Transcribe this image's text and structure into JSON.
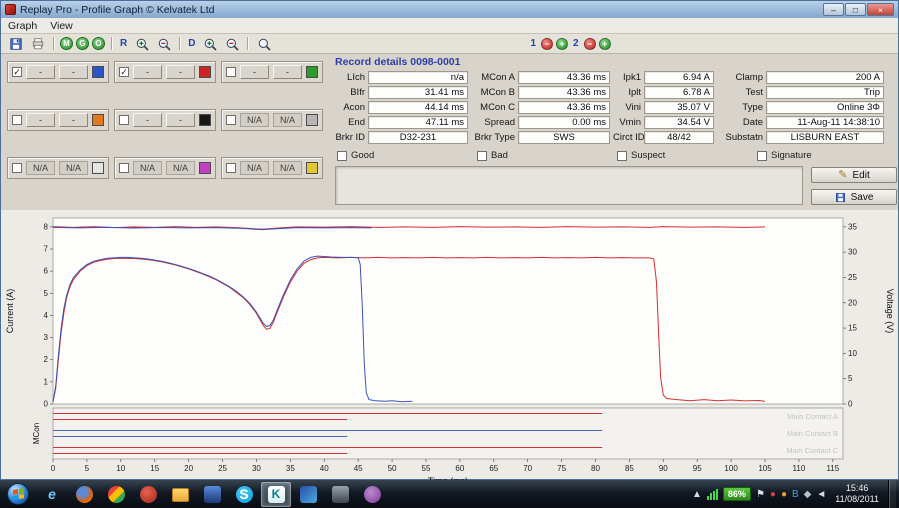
{
  "window": {
    "title": "Replay Pro - Profile Graph © Kelvatek Ltd",
    "menu": [
      "Graph",
      "View"
    ],
    "controls": {
      "minimize": "–",
      "maximize": "□",
      "close": "×"
    },
    "toolbar": {
      "green_letters": [
        "M",
        "G",
        "O"
      ],
      "r_label": "R",
      "d_label": "D",
      "cursor1_label": "1",
      "cursor2_label": "2",
      "minus_glyph": "−",
      "plus_glyph": "+"
    }
  },
  "channels": [
    {
      "checked": true,
      "btn1": "-",
      "btn2": "-",
      "color": "#2d55c8"
    },
    {
      "checked": true,
      "btn1": "-",
      "btn2": "-",
      "color": "#cc2424"
    },
    {
      "checked": false,
      "btn1": "-",
      "btn2": "-",
      "color": "#2d9a2d"
    },
    {
      "checked": false,
      "btn1": "-",
      "btn2": "-",
      "color": "#e07a20"
    },
    {
      "checked": false,
      "btn1": "-",
      "btn2": "-",
      "color": "#161616"
    },
    {
      "checked": false,
      "btn1": "N/A",
      "btn2": "N/A",
      "color": "#b5b5b5"
    },
    {
      "checked": false,
      "btn1": "N/A",
      "btn2": "N/A",
      "color": "#e4e4e4"
    },
    {
      "checked": false,
      "btn1": "N/A",
      "btn2": "N/A",
      "color": "#c43fc4"
    },
    {
      "checked": false,
      "btn1": "N/A",
      "btn2": "N/A",
      "color": "#e3c832"
    }
  ],
  "record": {
    "header": "Record details 0098-0001",
    "rows": [
      [
        {
          "label": "LIch",
          "value": "n/a"
        },
        {
          "label": "MCon A",
          "value": "43.36 ms"
        },
        {
          "label": "Ipk1",
          "value": "6.94 A"
        },
        {
          "label": "Clamp",
          "value": "200 A"
        }
      ],
      [
        {
          "label": "BIfr",
          "value": "31.41 ms"
        },
        {
          "label": "MCon B",
          "value": "43.36 ms"
        },
        {
          "label": "Iplt",
          "value": "6.78 A"
        },
        {
          "label": "Test",
          "value": "Trip"
        }
      ],
      [
        {
          "label": "Acon",
          "value": "44.14 ms"
        },
        {
          "label": "MCon C",
          "value": "43.36 ms"
        },
        {
          "label": "Vini",
          "value": "35.07 V"
        },
        {
          "label": "Type",
          "value": "Online 3Φ"
        }
      ],
      [
        {
          "label": "End",
          "value": "47.11 ms"
        },
        {
          "label": "Spread",
          "value": "0.00 ms"
        },
        {
          "label": "Vmin",
          "value": "34.54 V"
        },
        {
          "label": "Date",
          "value": "11-Aug-11 14:38:10"
        }
      ],
      [
        {
          "label": "Brkr ID",
          "value": "D32-231"
        },
        {
          "label": "Brkr Type",
          "value": "SWS"
        },
        {
          "label": "Circt ID",
          "value": "48/42"
        },
        {
          "label": "Substatn",
          "value": "LISBURN EAST"
        }
      ]
    ],
    "flags": [
      "Good",
      "Bad",
      "Suspect",
      "Signature"
    ],
    "buttons": {
      "edit": "Edit",
      "save": "Save"
    }
  },
  "chart_data": {
    "type": "line",
    "xlabel": "Time (ms)",
    "ylabel_left": "Current (A)",
    "ylabel_right": "Voltage (V)",
    "contacts_label": "MCon",
    "x_ticks": [
      0,
      5,
      10,
      15,
      20,
      25,
      30,
      35,
      40,
      45,
      50,
      55,
      60,
      65,
      70,
      75,
      80,
      85,
      90,
      95,
      100,
      105,
      110,
      115
    ],
    "current_ticks": [
      0,
      1,
      2,
      3,
      4,
      5,
      6,
      7,
      8
    ],
    "voltage_ticks": [
      0,
      5,
      10,
      15,
      20,
      25,
      30,
      35
    ],
    "xlim": [
      0,
      115
    ],
    "current_lim": [
      0,
      8
    ],
    "voltage_lim": [
      0,
      35
    ],
    "series": [
      {
        "name": "voltage-red",
        "axis": "voltage",
        "color": "#d42f2f",
        "points": [
          [
            0,
            35.05
          ],
          [
            3,
            34.9
          ],
          [
            6,
            35.05
          ],
          [
            9,
            34.85
          ],
          [
            12,
            35.0
          ],
          [
            15,
            34.9
          ],
          [
            18,
            35.05
          ],
          [
            21,
            34.9
          ],
          [
            24,
            35.0
          ],
          [
            27,
            34.85
          ],
          [
            30,
            34.6
          ],
          [
            31,
            34.55
          ],
          [
            32,
            34.65
          ],
          [
            34,
            34.85
          ],
          [
            36,
            35.0
          ],
          [
            40,
            34.95
          ],
          [
            44,
            35.05
          ],
          [
            48,
            34.9
          ],
          [
            52,
            35.0
          ],
          [
            56,
            34.9
          ],
          [
            60,
            35.05
          ],
          [
            64,
            34.95
          ],
          [
            68,
            35.0
          ],
          [
            72,
            34.9
          ],
          [
            76,
            35.05
          ],
          [
            80,
            34.95
          ],
          [
            84,
            35.0
          ],
          [
            88,
            34.9
          ],
          [
            90,
            35.05
          ],
          [
            94,
            34.95
          ],
          [
            98,
            35.0
          ],
          [
            102,
            34.9
          ],
          [
            105,
            35.0
          ]
        ]
      },
      {
        "name": "voltage-blue",
        "axis": "voltage",
        "color": "#3a53b4",
        "points": [
          [
            0,
            34.9
          ],
          [
            4,
            34.8
          ],
          [
            8,
            34.9
          ],
          [
            12,
            34.78
          ],
          [
            16,
            34.88
          ],
          [
            20,
            34.8
          ],
          [
            24,
            34.85
          ],
          [
            28,
            34.7
          ],
          [
            30,
            34.5
          ],
          [
            31,
            34.45
          ],
          [
            32,
            34.55
          ],
          [
            34,
            34.7
          ],
          [
            36,
            34.85
          ],
          [
            40,
            34.8
          ],
          [
            44,
            34.85
          ],
          [
            47,
            34.8
          ]
        ]
      },
      {
        "name": "current-red",
        "axis": "current",
        "color": "#d42f2f",
        "points": [
          [
            0,
            0.1
          ],
          [
            0.4,
            0.7
          ],
          [
            0.8,
            2.0
          ],
          [
            1.2,
            3.2
          ],
          [
            1.6,
            4.1
          ],
          [
            2,
            4.8
          ],
          [
            2.5,
            5.3
          ],
          [
            3,
            5.6
          ],
          [
            4,
            6.0
          ],
          [
            5,
            6.25
          ],
          [
            6,
            6.4
          ],
          [
            7,
            6.48
          ],
          [
            8,
            6.54
          ],
          [
            9,
            6.57
          ],
          [
            10,
            6.58
          ],
          [
            12,
            6.57
          ],
          [
            14,
            6.52
          ],
          [
            16,
            6.42
          ],
          [
            18,
            6.28
          ],
          [
            20,
            6.1
          ],
          [
            22,
            5.88
          ],
          [
            24,
            5.62
          ],
          [
            26,
            5.28
          ],
          [
            28,
            4.82
          ],
          [
            29,
            4.5
          ],
          [
            30,
            4.1
          ],
          [
            30.5,
            3.82
          ],
          [
            31,
            3.55
          ],
          [
            31.5,
            3.38
          ],
          [
            32,
            3.42
          ],
          [
            32.5,
            3.7
          ],
          [
            33,
            4.1
          ],
          [
            34,
            4.85
          ],
          [
            35,
            5.5
          ],
          [
            36,
            6.0
          ],
          [
            37,
            6.35
          ],
          [
            38,
            6.52
          ],
          [
            39,
            6.6
          ],
          [
            40,
            6.62
          ],
          [
            42,
            6.6
          ],
          [
            44,
            6.62
          ],
          [
            46,
            6.6
          ],
          [
            48,
            6.62
          ],
          [
            50,
            6.6
          ],
          [
            52,
            6.61
          ],
          [
            54,
            6.6
          ],
          [
            56,
            6.62
          ],
          [
            58,
            6.6
          ],
          [
            60,
            6.61
          ],
          [
            62,
            6.6
          ],
          [
            64,
            6.62
          ],
          [
            66,
            6.6
          ],
          [
            68,
            6.61
          ],
          [
            70,
            6.6
          ],
          [
            72,
            6.62
          ],
          [
            74,
            6.6
          ],
          [
            76,
            6.61
          ],
          [
            78,
            6.6
          ],
          [
            80,
            6.62
          ],
          [
            82,
            6.6
          ],
          [
            84,
            6.61
          ],
          [
            86,
            6.6
          ],
          [
            88,
            6.6
          ],
          [
            88.6,
            6.55
          ],
          [
            89,
            5.5
          ],
          [
            89.3,
            3.2
          ],
          [
            89.6,
            1.2
          ],
          [
            90,
            0.4
          ],
          [
            90.5,
            0.25
          ],
          [
            92,
            0.2
          ],
          [
            94,
            0.15
          ],
          [
            96,
            0.2
          ],
          [
            98,
            0.15
          ],
          [
            100,
            0.18
          ],
          [
            102,
            0.14
          ],
          [
            104,
            0.16
          ],
          [
            105,
            0.12
          ]
        ]
      },
      {
        "name": "current-blue",
        "axis": "current",
        "color": "#3a53b4",
        "points": [
          [
            0,
            0.1
          ],
          [
            0.4,
            0.8
          ],
          [
            0.8,
            2.2
          ],
          [
            1.2,
            3.4
          ],
          [
            1.6,
            4.3
          ],
          [
            2,
            4.9
          ],
          [
            2.5,
            5.4
          ],
          [
            3,
            5.7
          ],
          [
            4,
            6.05
          ],
          [
            5,
            6.3
          ],
          [
            6,
            6.45
          ],
          [
            7,
            6.52
          ],
          [
            8,
            6.58
          ],
          [
            9,
            6.6
          ],
          [
            10,
            6.62
          ],
          [
            11,
            6.62
          ],
          [
            12,
            6.6
          ],
          [
            13,
            6.58
          ],
          [
            14,
            6.55
          ],
          [
            15,
            6.5
          ],
          [
            16,
            6.45
          ],
          [
            17,
            6.38
          ],
          [
            18,
            6.3
          ],
          [
            19,
            6.22
          ],
          [
            20,
            6.12
          ],
          [
            21,
            6.02
          ],
          [
            22,
            5.9
          ],
          [
            23,
            5.78
          ],
          [
            24,
            5.64
          ],
          [
            25,
            5.48
          ],
          [
            26,
            5.3
          ],
          [
            27,
            5.1
          ],
          [
            28,
            4.85
          ],
          [
            29,
            4.55
          ],
          [
            30,
            4.15
          ],
          [
            30.5,
            3.9
          ],
          [
            31,
            3.65
          ],
          [
            31.5,
            3.5
          ],
          [
            32,
            3.55
          ],
          [
            32.5,
            3.8
          ],
          [
            33,
            4.2
          ],
          [
            34,
            4.95
          ],
          [
            35,
            5.6
          ],
          [
            36,
            6.1
          ],
          [
            37,
            6.45
          ],
          [
            38,
            6.62
          ],
          [
            39,
            6.68
          ],
          [
            40,
            6.66
          ],
          [
            41,
            6.64
          ],
          [
            42,
            6.63
          ],
          [
            43,
            6.62
          ],
          [
            44,
            6.62
          ],
          [
            45,
            6.6
          ],
          [
            45.3,
            6.3
          ],
          [
            45.6,
            4.5
          ],
          [
            45.9,
            1.8
          ],
          [
            46.2,
            0.5
          ],
          [
            46.6,
            0.2
          ],
          [
            47.5,
            0.15
          ],
          [
            49,
            0.12
          ],
          [
            50,
            0.15
          ],
          [
            51.5,
            0.1
          ],
          [
            53,
            0.12
          ]
        ]
      }
    ],
    "contacts": {
      "rows": [
        {
          "label": "Main Contact A",
          "segments": [
            {
              "x0": 0,
              "x1": 81,
              "offset": -3,
              "color": "#cc3434"
            },
            {
              "x0": 0,
              "x1": 43.4,
              "offset": 3,
              "color": "#cc3434"
            }
          ]
        },
        {
          "label": "Main Contact B",
          "segments": [
            {
              "x0": 0,
              "x1": 81,
              "offset": -3,
              "color": "#4a66b8"
            },
            {
              "x0": 0,
              "x1": 43.4,
              "offset": 3,
              "color": "#4a66b8"
            }
          ]
        },
        {
          "label": "Main Contact C",
          "segments": [
            {
              "x0": 0,
              "x1": 81,
              "offset": -3,
              "color": "#cc3434"
            },
            {
              "x0": 0,
              "x1": 43.4,
              "offset": 3,
              "color": "#cc3434"
            }
          ]
        }
      ]
    }
  },
  "taskbar": {
    "apps": [
      {
        "name": "internet-explorer",
        "shape": "none",
        "glyph": "e",
        "glyph_color": "#6ec6f2",
        "italic": true,
        "bg": ""
      },
      {
        "name": "firefox",
        "shape": "circ",
        "glyph": "",
        "bg": "radial-gradient(circle at 38% 35%, #5a8ad8 0%, #5a8ad8 30%, #e66000 62%, #f9a13a 100%)"
      },
      {
        "name": "chrome",
        "shape": "circ",
        "glyph": "",
        "bg": "linear-gradient(135deg, #ea4335 0%, #ea4335 34%, #fbbc05 34%, #fbbc05 62%, #34a853 62%, #34a853 100%)"
      },
      {
        "name": "red-circle-app",
        "shape": "circ",
        "glyph": "",
        "bg": "radial-gradient(circle at 40% 35%, #e86050, #a02818)"
      },
      {
        "name": "windows-explorer",
        "shape": "folder",
        "glyph": "",
        "bg": ""
      },
      {
        "name": "blue-window-app",
        "shape": "sq",
        "glyph": "",
        "bg": "linear-gradient(#5a8ad8,#1a3a78)"
      },
      {
        "name": "skype",
        "shape": "circ",
        "glyph": "S",
        "glyph_color": "#ffffff",
        "bg": "radial-gradient(circle at 40% 35%, #4ec9f5, #009ed8)"
      },
      {
        "name": "replay-pro",
        "shape": "sq",
        "glyph": "K",
        "glyph_color": "#0b7c8c",
        "bg": "linear-gradient(#ffffff,#d8ecef)",
        "active": true
      },
      {
        "name": "blue-grid-app",
        "shape": "sq",
        "glyph": "",
        "bg": "linear-gradient(135deg,#2a4fa8,#4aa8e0)"
      },
      {
        "name": "monitor-app",
        "shape": "sq",
        "glyph": "",
        "bg": "linear-gradient(#9aa4ae,#3c444c)"
      },
      {
        "name": "purple-app",
        "shape": "circ",
        "glyph": "",
        "bg": "radial-gradient(circle at 40% 35%, #c08ad0, #7a3a9a)"
      }
    ],
    "tray": {
      "battery": "86%",
      "icons": [
        {
          "name": "show-hidden-icons",
          "glyph": "▲",
          "color": "#d8dde4"
        },
        {
          "name": "signal-bars",
          "type": "bars"
        },
        {
          "name": "battery-meter",
          "type": "badge"
        },
        {
          "name": "action-center-flag",
          "glyph": "⚑",
          "color": "#d8e0ea"
        },
        {
          "name": "security-alert",
          "glyph": "●",
          "color": "#d04040"
        },
        {
          "name": "update-notifier",
          "glyph": "●",
          "color": "#e8a030"
        },
        {
          "name": "bluetooth",
          "glyph": "B",
          "color": "#4a9ae0"
        },
        {
          "name": "usb-device",
          "glyph": "◆",
          "color": "#b8c0cc"
        },
        {
          "name": "volume",
          "glyph": "◄",
          "color": "#d8d8d8"
        }
      ],
      "clock_time": "15:46",
      "clock_date": "11/08/2011"
    }
  }
}
